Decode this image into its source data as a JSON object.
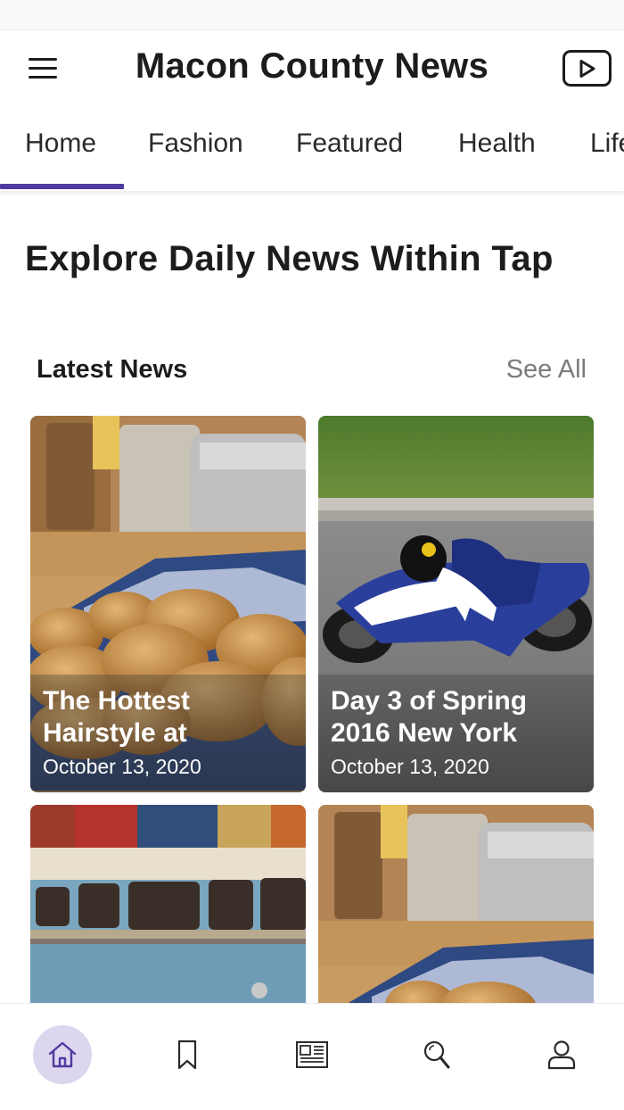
{
  "header": {
    "title": "Macon County News",
    "menu_icon": "hamburger-menu-icon",
    "video_icon": "video-play-icon"
  },
  "tabs": [
    {
      "label": "Home",
      "active": true
    },
    {
      "label": "Fashion",
      "active": false
    },
    {
      "label": "Featured",
      "active": false
    },
    {
      "label": "Health",
      "active": false
    },
    {
      "label": "Lifestyle",
      "active": false
    }
  ],
  "headline": "Explore Daily News Within Tap",
  "latest": {
    "title": "Latest News",
    "see_all": "See All",
    "cards": [
      {
        "title": "The Hottest Hairstyle at",
        "date": "October 13, 2020",
        "image": "potatoes-basket-photo"
      },
      {
        "title": "Day 3 of Spring 2016 New York",
        "date": "October 13, 2020",
        "image": "motorcycle-racer-photo"
      },
      {
        "title": "",
        "date": "",
        "image": "rusty-van-photo"
      },
      {
        "title": "",
        "date": "",
        "image": "potatoes-basket-photo"
      }
    ]
  },
  "bottom_nav": [
    {
      "icon": "home-icon",
      "active": true
    },
    {
      "icon": "bookmark-icon",
      "active": false
    },
    {
      "icon": "newspaper-icon",
      "active": false
    },
    {
      "icon": "search-icon",
      "active": false
    },
    {
      "icon": "profile-icon",
      "active": false
    }
  ],
  "colors": {
    "accent": "#4f3aa0",
    "active_nav_bg": "#ddd6ef",
    "text": "#1c1c1e",
    "muted": "#7b7b7e"
  }
}
